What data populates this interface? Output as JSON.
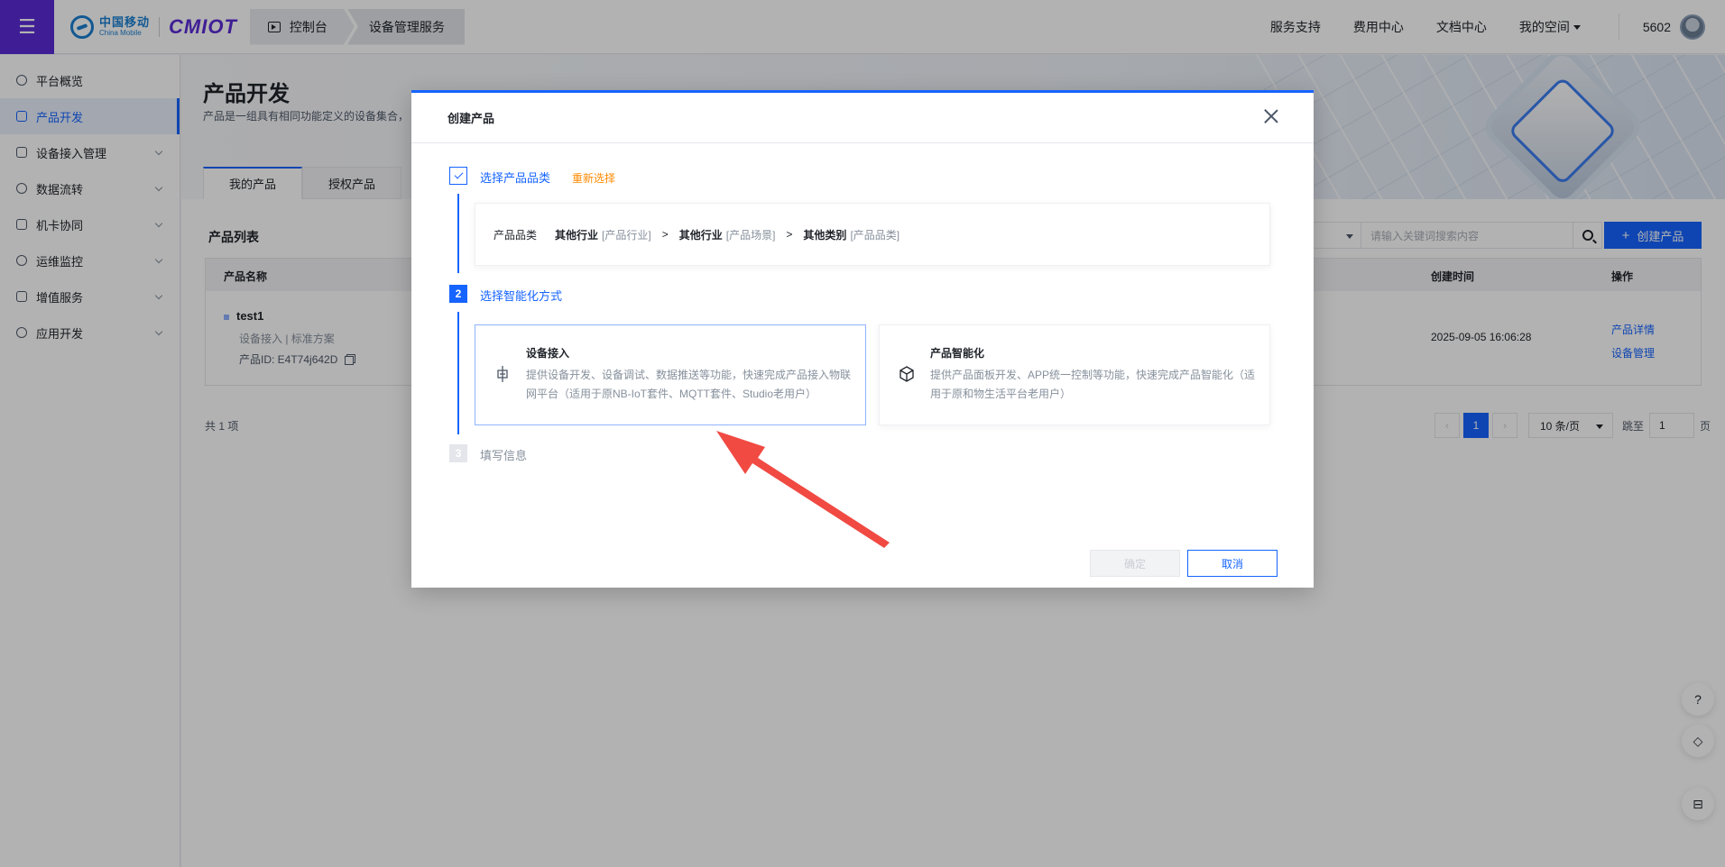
{
  "header": {
    "menu_icon": "hamburger-icon",
    "logo_cn": "中国移动",
    "logo_en": "China Mobile",
    "logo_product": "CMIOT",
    "breadcrumbs": [
      "控制台",
      "设备管理服务"
    ],
    "links": [
      "服务支持",
      "费用中心",
      "文档中心",
      "我的空间"
    ],
    "user_id": "5602",
    "brand_color": "#5b2bd6"
  },
  "sidebar": {
    "items": [
      {
        "label": "平台概览",
        "icon": "overview-icon"
      },
      {
        "label": "产品开发",
        "icon": "product-icon"
      },
      {
        "label": "设备接入管理",
        "icon": "device-icon"
      },
      {
        "label": "数据流转",
        "icon": "dataflow-icon"
      },
      {
        "label": "机卡协同",
        "icon": "sim-icon"
      },
      {
        "label": "运维监控",
        "icon": "monitor-icon"
      },
      {
        "label": "增值服务",
        "icon": "service-icon"
      },
      {
        "label": "应用开发",
        "icon": "app-icon"
      }
    ],
    "active": "产品开发",
    "accent_color": "#1664ff"
  },
  "page": {
    "title": "产品开发",
    "description": "产品是一组具有相同功能定义的设备集合，",
    "tabs": [
      "我的产品",
      "授权产品"
    ],
    "list_title": "产品列表",
    "search_placeholder": "请输入关键词搜索内容",
    "create_label": "创建产品",
    "table": {
      "headers": [
        "产品名称",
        "创建时间",
        "操作"
      ],
      "rows": [
        {
          "name": "test1",
          "meta": "设备接入 | 标准方案",
          "id": "产品ID:  E4T74j642D",
          "created": "2025-09-05 16:06:28",
          "actions": [
            "产品详情",
            "设备管理"
          ]
        }
      ]
    },
    "total": "共 1 项",
    "pager": {
      "prev": "‹",
      "current": "1",
      "next": "›",
      "size": "10 条/页",
      "jump_label": "跳至",
      "jump_value": "1",
      "page_unit": "页"
    }
  },
  "float_buttons": [
    {
      "icon": "help-icon",
      "glyph": "?"
    },
    {
      "icon": "service-hub-icon",
      "glyph": "◇"
    },
    {
      "icon": "panel-icon",
      "glyph": "⊟"
    }
  ],
  "modal": {
    "title": "创建产品",
    "step1": {
      "label": "选择产品品类",
      "reselect": "重新选择",
      "category_label": "产品品类",
      "path": [
        {
          "name": "其他行业",
          "tag": "[产品行业]"
        },
        {
          "name": "其他行业",
          "tag": "[产品场景]"
        },
        {
          "name": "其他类别",
          "tag": "[产品品类]"
        }
      ],
      "separator": ">"
    },
    "step2": {
      "number": "2",
      "label": "选择智能化方式",
      "options": [
        {
          "title": "设备接入",
          "desc": "提供设备开发、设备调试、数据推送等功能，快速完成产品接入物联网平台（适用于原NB-IoT套件、MQTT套件、Studio老用户）",
          "icon": "device-access-icon"
        },
        {
          "title": "产品智能化",
          "desc": "提供产品面板开发、APP统一控制等功能，快速完成产品智能化（适用于原和物生活平台老用户）",
          "icon": "cube-icon"
        }
      ]
    },
    "step3": {
      "number": "3",
      "label": "填写信息"
    },
    "confirm_label": "确定",
    "cancel_label": "取消"
  }
}
